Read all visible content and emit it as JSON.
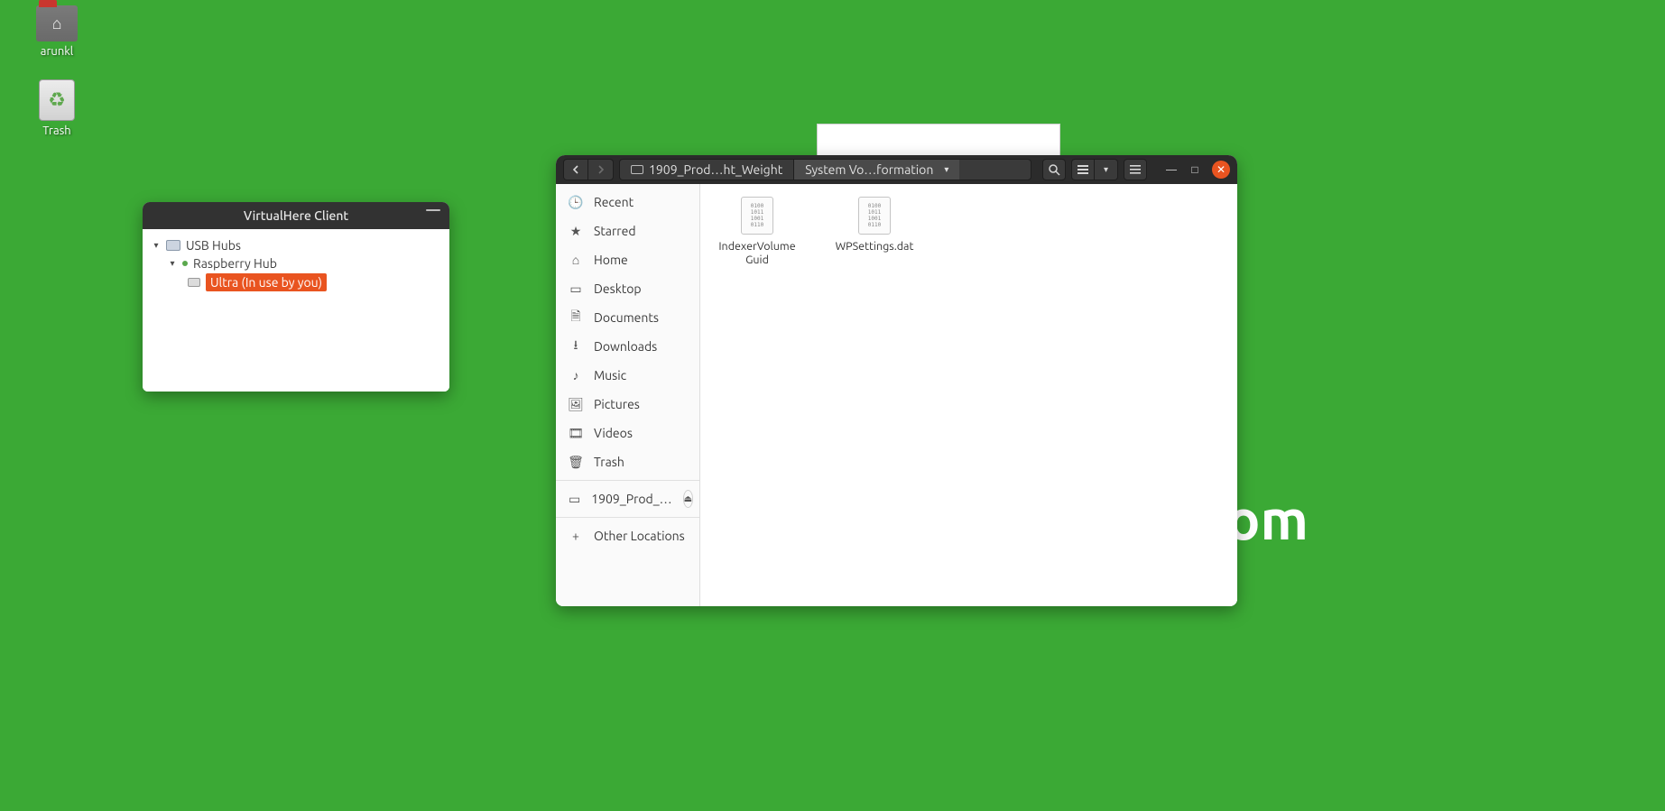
{
  "desktop": {
    "folder_label": "arunkl",
    "trash_label": "Trash"
  },
  "watermark_fragment": "om",
  "vh": {
    "title": "VirtualHere Client",
    "root": "USB Hubs",
    "hub": "Raspberry Hub",
    "device": "Ultra (In use by you)"
  },
  "files": {
    "path_seg1": "1909_Prod…ht_Weight",
    "path_seg2": "System Vo…formation",
    "sidebar": {
      "recent": "Recent",
      "starred": "Starred",
      "home": "Home",
      "desktop": "Desktop",
      "documents": "Documents",
      "downloads": "Downloads",
      "music": "Music",
      "pictures": "Pictures",
      "videos": "Videos",
      "trash": "Trash",
      "drive": "1909_Prod_…",
      "other": "Other Locations"
    },
    "items": [
      {
        "name": "IndexerVolumeGuid"
      },
      {
        "name": "WPSettings.dat"
      }
    ]
  }
}
